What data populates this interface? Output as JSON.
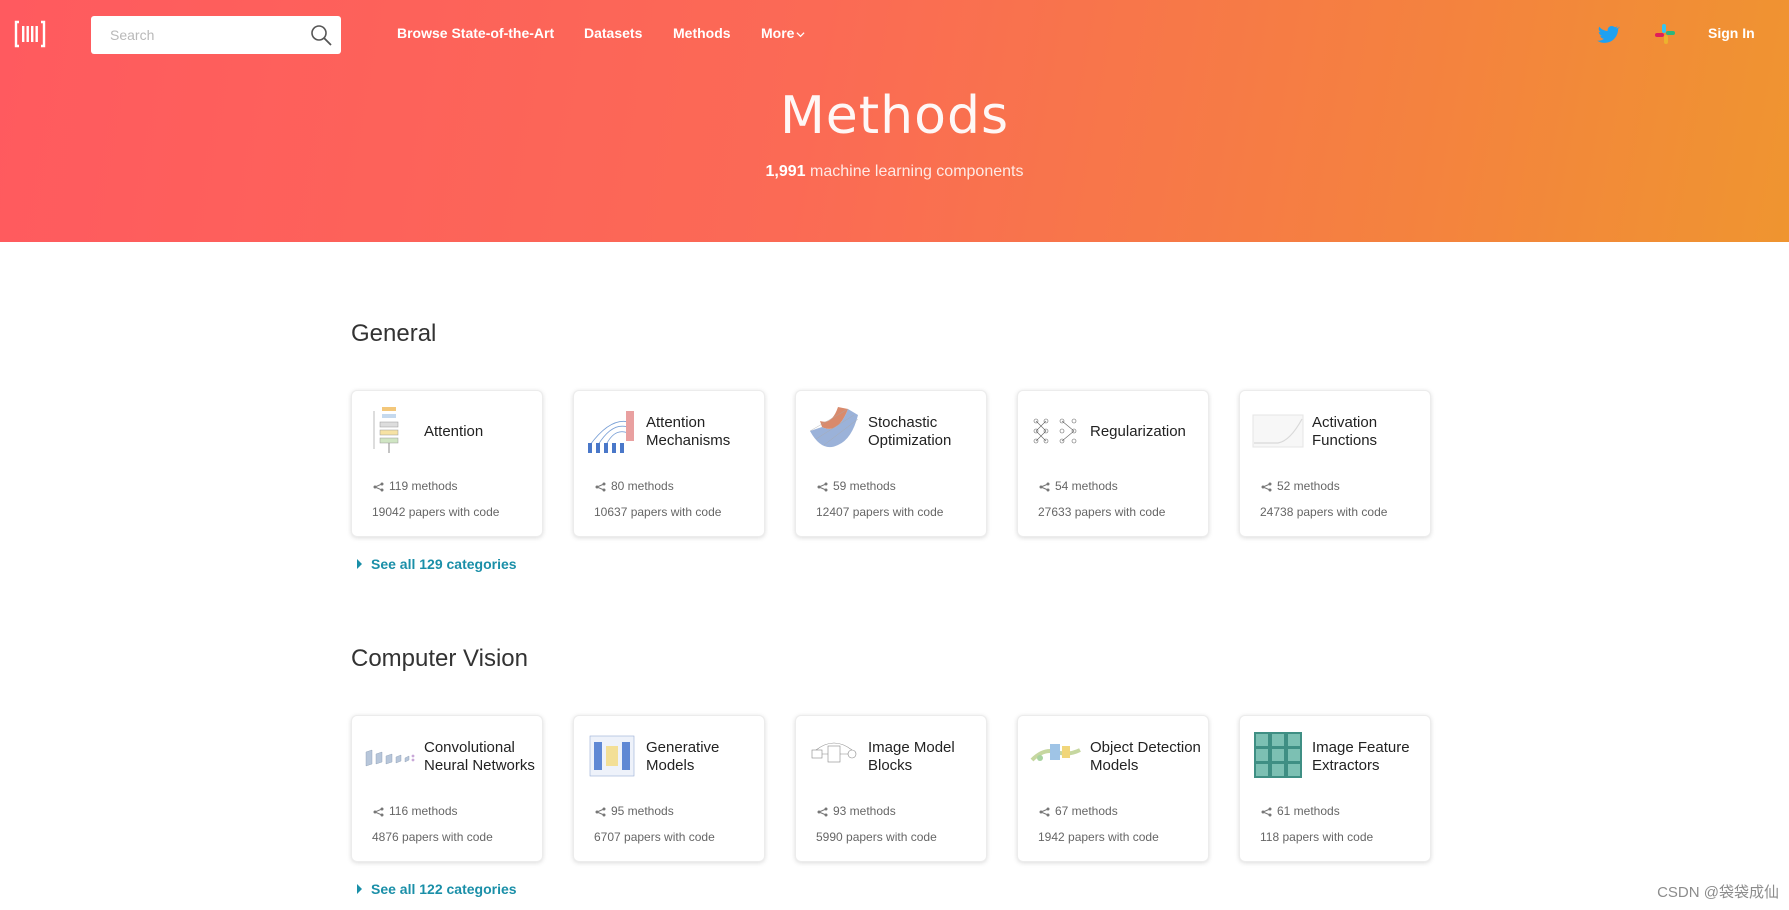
{
  "header": {
    "search_placeholder": "Search",
    "nav": [
      "Browse State-of-the-Art",
      "Datasets",
      "Methods",
      "More"
    ],
    "sign_in": "Sign In"
  },
  "hero": {
    "title": "Methods",
    "count": "1,991",
    "subtitle_rest": " machine learning components"
  },
  "sections": [
    {
      "title": "General",
      "see_all": "See all 129 categories",
      "cards": [
        {
          "name": "Attention",
          "methods": "119 methods",
          "papers": "19042 papers with code",
          "thumb": "attention-diagram"
        },
        {
          "name": "Attention Mechanisms",
          "methods": "80 methods",
          "papers": "10637 papers with code",
          "thumb": "attention-mechanism-diagram"
        },
        {
          "name": "Stochastic Optimization",
          "methods": "59 methods",
          "papers": "12407 papers with code",
          "thumb": "loss-surface"
        },
        {
          "name": "Regularization",
          "methods": "54 methods",
          "papers": "27633 papers with code",
          "thumb": "dropout-network"
        },
        {
          "name": "Activation Functions",
          "methods": "52 methods",
          "papers": "24738 papers with code",
          "thumb": "activation-curve"
        }
      ]
    },
    {
      "title": "Computer Vision",
      "see_all": "See all 122 categories",
      "cards": [
        {
          "name": "Convolutional Neural Networks",
          "methods": "116 methods",
          "papers": "4876 papers with code",
          "thumb": "cnn-diagram"
        },
        {
          "name": "Generative Models",
          "methods": "95 methods",
          "papers": "6707 papers with code",
          "thumb": "generative-diagram"
        },
        {
          "name": "Image Model Blocks",
          "methods": "93 methods",
          "papers": "5990 papers with code",
          "thumb": "block-diagram"
        },
        {
          "name": "Object Detection Models",
          "methods": "67 methods",
          "papers": "1942 papers with code",
          "thumb": "detection-diagram"
        },
        {
          "name": "Image Feature Extractors",
          "methods": "61 methods",
          "papers": "118 papers with code",
          "thumb": "feature-grid"
        }
      ]
    }
  ],
  "watermark": "CSDN @袋袋成仙",
  "colors": {
    "gradient_start": "#ff5a5f",
    "gradient_end": "#ef9530",
    "link": "#1a8fa8",
    "twitter": "#1da1f2"
  }
}
